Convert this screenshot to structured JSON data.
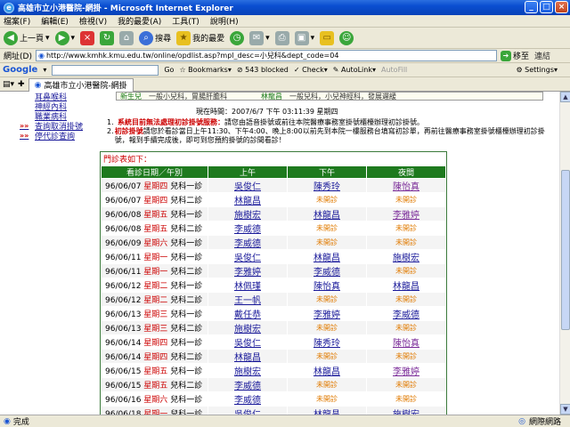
{
  "window": {
    "title": "高雄市立小港醫院-網掛 - Microsoft Internet Explorer",
    "icon": "ie-icon"
  },
  "menu": [
    "檔案(F)",
    "編輯(E)",
    "檢視(V)",
    "我的最愛(A)",
    "工具(T)",
    "說明(H)"
  ],
  "toolbar": {
    "back": "上一頁",
    "search": "搜尋",
    "favorites": "我的最愛"
  },
  "address": {
    "label": "網址(D)",
    "url": "http://www.kmhk.kmu.edu.tw/online/opdlist.asp?mpl_desc=小兒科&dept_code=04",
    "go": "移至",
    "links": "連結"
  },
  "googlebar": {
    "logo": "Google",
    "go": "Go",
    "bookmarks": "Bookmarks",
    "blocked": "543 blocked",
    "check": "Check",
    "autolink": "AutoLink",
    "autofill": "AutoFill",
    "settings": "Settings"
  },
  "tab": {
    "label": "高雄市立小港醫院-網掛"
  },
  "status": {
    "left": "完成",
    "right": "網際網路"
  },
  "sidenav": [
    {
      "mk": "",
      "label": "耳鼻喉科"
    },
    {
      "mk": "",
      "label": "神經內科"
    },
    {
      "mk": "",
      "label": "職業病科"
    },
    {
      "mk": "»»",
      "label": "查詢取消掛號"
    },
    {
      "mk": "»»",
      "label": "停代診查詢"
    }
  ],
  "dept": {
    "a": "新生兒",
    "a_desc": "一般小兒科，胃腸肝膽科",
    "b": "林龍昌",
    "b_desc": "一般兒科，小兒神經科，發展遲緩"
  },
  "nowtime": "現在時間：2007/6/7 下午 03:11:39 星期四",
  "notes": [
    {
      "num": "1.",
      "red": "系統目前無法處理初診掛號服務：",
      "text": "請您由語音掛號或前往本院醫療事務室掛號櫃檯辦理初診掛號。"
    },
    {
      "num": "2.",
      "red": "初診掛號",
      "text": "請您於看診當日上午11:30、下午4:00、晚上8:00以前先到本院一樓服務台填寫初診單，再前往醫療事務室掛號櫃檯辦理初診掛號，報到手續完成後，即可到您預約掛號的診間看診！"
    }
  ],
  "table": {
    "caption": "門診表如下：",
    "headers": [
      "看診日期／午別",
      "上午",
      "下午",
      "夜間"
    ],
    "rows": [
      {
        "date": "96/06/07",
        "wd": "星期四",
        "clinic": "兒科一診",
        "am": "吳俊仁",
        "pm": "陳秀玲",
        "night": "陳怡真"
      },
      {
        "date": "96/06/07",
        "wd": "星期四",
        "clinic": "兒科二診",
        "am": "林龍昌",
        "pm": "未開診",
        "night": "未開診"
      },
      {
        "date": "96/06/08",
        "wd": "星期五",
        "clinic": "兒科一診",
        "am": "施樹宏",
        "pm": "林龍昌",
        "night": "李雅婷"
      },
      {
        "date": "96/06/08",
        "wd": "星期五",
        "clinic": "兒科二診",
        "am": "李威德",
        "pm": "未開診",
        "night": "未開診"
      },
      {
        "date": "96/06/09",
        "wd": "星期六",
        "clinic": "兒科一診",
        "am": "李威德",
        "pm": "未開診",
        "night": "未開診"
      },
      {
        "date": "96/06/11",
        "wd": "星期一",
        "clinic": "兒科一診",
        "am": "吳俊仁",
        "pm": "林龍昌",
        "night": "施樹宏"
      },
      {
        "date": "96/06/11",
        "wd": "星期一",
        "clinic": "兒科二診",
        "am": "李雅婷",
        "pm": "李威德",
        "night": "未開診"
      },
      {
        "date": "96/06/12",
        "wd": "星期二",
        "clinic": "兒科一診",
        "am": "林佩瑾",
        "pm": "陳怡真",
        "night": "林龍昌"
      },
      {
        "date": "96/06/12",
        "wd": "星期二",
        "clinic": "兒科二診",
        "am": "王一帆",
        "pm": "未開診",
        "night": "未開診"
      },
      {
        "date": "96/06/13",
        "wd": "星期三",
        "clinic": "兒科一診",
        "am": "戴任恭",
        "pm": "李雅婷",
        "night": "李威德"
      },
      {
        "date": "96/06/13",
        "wd": "星期三",
        "clinic": "兒科二診",
        "am": "施樹宏",
        "pm": "未開診",
        "night": "未開診"
      },
      {
        "date": "96/06/14",
        "wd": "星期四",
        "clinic": "兒科一診",
        "am": "吳俊仁",
        "pm": "陳秀玲",
        "night": "陳怡真"
      },
      {
        "date": "96/06/14",
        "wd": "星期四",
        "clinic": "兒科二診",
        "am": "林龍昌",
        "pm": "未開診",
        "night": "未開診"
      },
      {
        "date": "96/06/15",
        "wd": "星期五",
        "clinic": "兒科一診",
        "am": "施樹宏",
        "pm": "林龍昌",
        "night": "李雅婷"
      },
      {
        "date": "96/06/15",
        "wd": "星期五",
        "clinic": "兒科二診",
        "am": "李威德",
        "pm": "未開診",
        "night": "未開診"
      },
      {
        "date": "96/06/16",
        "wd": "星期六",
        "clinic": "兒科一診",
        "am": "李威德",
        "pm": "未開診",
        "night": "未開診"
      },
      {
        "date": "96/06/18",
        "wd": "星期一",
        "clinic": "兒科一診",
        "am": "吳俊仁",
        "pm": "林龍昌",
        "night": "施樹宏"
      }
    ]
  }
}
